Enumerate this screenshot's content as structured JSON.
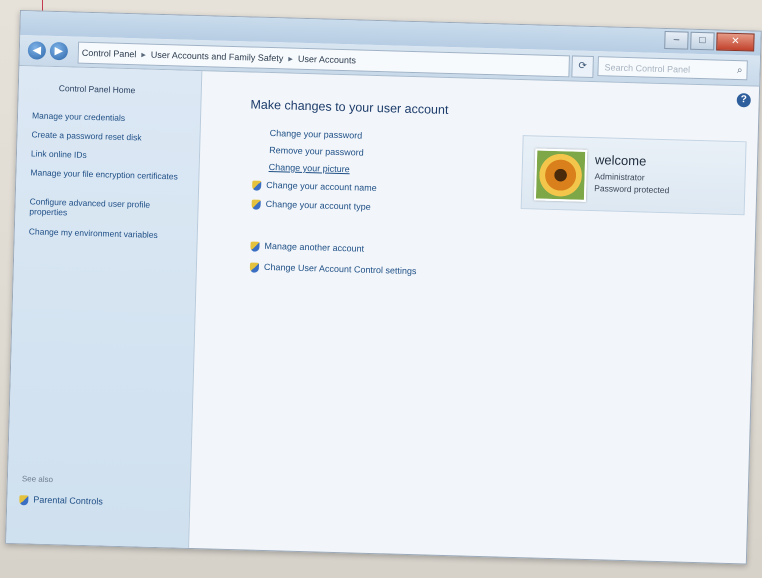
{
  "window": {
    "controls": {
      "minimize": "–",
      "maximize": "□",
      "close": "✕"
    }
  },
  "address": {
    "back_icon": "◀",
    "forward_icon": "▶",
    "crumbs": [
      "Control Panel",
      "User Accounts and Family Safety",
      "User Accounts"
    ],
    "separator": "▸",
    "refresh_icon": "⟳",
    "search_placeholder": "Search Control Panel",
    "search_icon": "⌕"
  },
  "sidebar": {
    "home": "Control Panel Home",
    "items": [
      "Manage your credentials",
      "Create a password reset disk",
      "Link online IDs",
      "Manage your file encryption certificates",
      "Configure advanced user profile properties",
      "Change my environment variables"
    ],
    "see_also_label": "See also",
    "parental_controls": "Parental Controls"
  },
  "main": {
    "title": "Make changes to your user account",
    "help_icon": "?",
    "links": [
      "Change your password",
      "Remove your password",
      "Change your picture",
      "Change your account name",
      "Change your account type",
      "Manage another account",
      "Change User Account Control settings"
    ]
  },
  "user": {
    "name": "welcome",
    "role": "Administrator",
    "status": "Password protected"
  },
  "colors": {
    "accent": "#1f4f86",
    "annotation": "#c43a4e"
  }
}
